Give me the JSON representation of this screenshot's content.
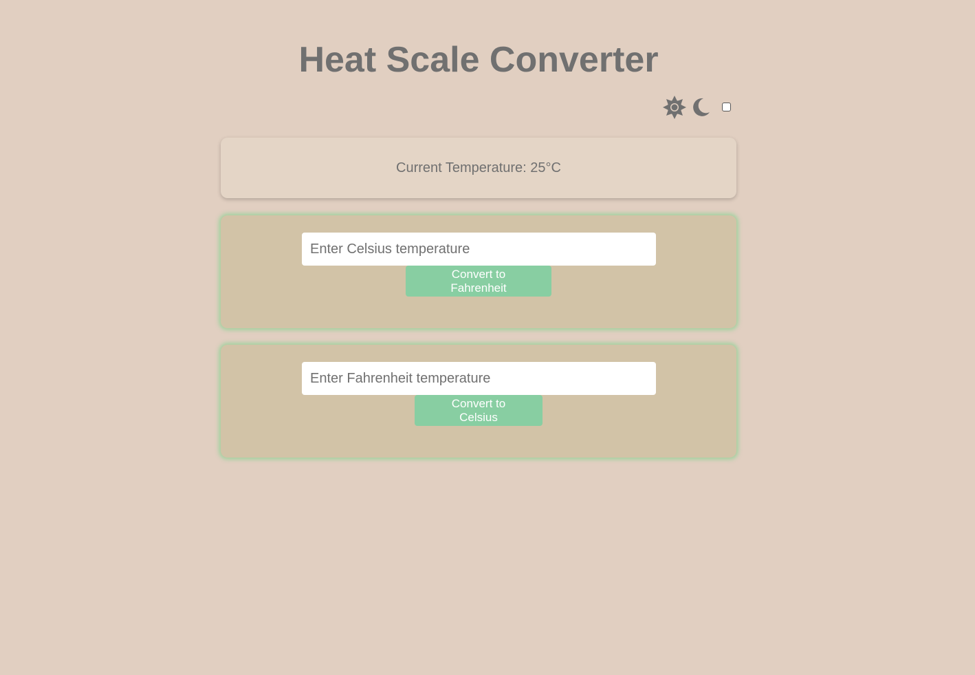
{
  "header": {
    "title": "Heat Scale Converter"
  },
  "theme_toggle": {
    "light_icon": "sun-icon",
    "dark_icon": "moon-icon",
    "checked": false
  },
  "current": {
    "text": "Current Temperature: 25°C"
  },
  "celsius_converter": {
    "placeholder": "Enter Celsius temperature",
    "value": "",
    "button_label": "Convert to Fahrenheit"
  },
  "fahrenheit_converter": {
    "placeholder": "Enter Fahrenheit temperature",
    "value": "",
    "button_label": "Convert to Celsius"
  },
  "colors": {
    "background": "#e1cfc1",
    "text": "#707070",
    "card": "#e4d5c6",
    "converter_card": "#d2c3a7",
    "accent": "#88cea2",
    "glow": "#90d296"
  }
}
